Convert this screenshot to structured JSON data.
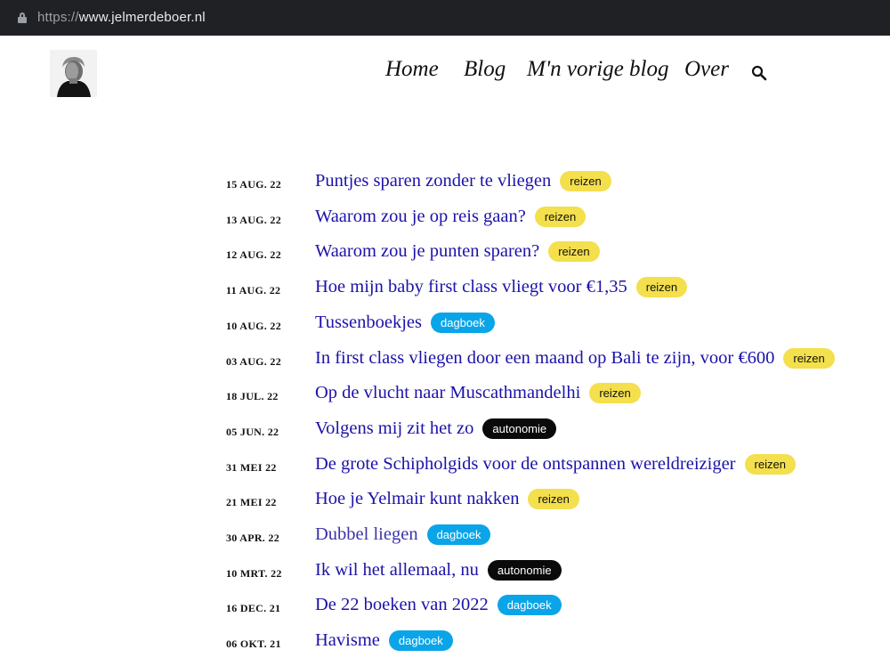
{
  "browser": {
    "url_scheme": "https://",
    "url_host": "www.jelmerdeboer.nl"
  },
  "nav": {
    "items": [
      {
        "label": "Home"
      },
      {
        "label": "Blog"
      },
      {
        "label": "M'n vorige blog"
      },
      {
        "label": "Over"
      }
    ]
  },
  "posts": [
    {
      "date": "15 AUG. 22",
      "title": "Puntjes sparen zonder te vliegen",
      "tag": "reizen"
    },
    {
      "date": "13 AUG. 22",
      "title": "Waarom zou je op reis gaan?",
      "tag": "reizen"
    },
    {
      "date": "12 AUG. 22",
      "title": "Waarom zou je punten sparen?",
      "tag": "reizen"
    },
    {
      "date": "11 AUG. 22",
      "title": "Hoe mijn baby first class vliegt voor €1,35",
      "tag": "reizen"
    },
    {
      "date": "10 AUG. 22",
      "title": "Tussenboekjes",
      "tag": "dagboek"
    },
    {
      "date": "03 AUG. 22",
      "title": "In first class vliegen door een maand op Bali te zijn, voor €600",
      "tag": "reizen"
    },
    {
      "date": "18 JUL. 22",
      "title": "Op de vlucht naar Muscathmandelhi",
      "tag": "reizen"
    },
    {
      "date": "05 JUN. 22",
      "title": "Volgens mij zit het zo",
      "tag": "autonomie"
    },
    {
      "date": "31 MEI 22",
      "title": "De grote Schipholgids voor de ontspannen wereldreiziger",
      "tag": "reizen"
    },
    {
      "date": "21 MEI 22",
      "title": "Hoe je Yelmair kunt nakken",
      "tag": "reizen"
    },
    {
      "date": "30 APR. 22",
      "title": "Dubbel liegen",
      "tag": "dagboek"
    },
    {
      "date": "10 MRT. 22",
      "title": "Ik wil het allemaal, nu",
      "tag": "autonomie"
    },
    {
      "date": "16 DEC. 21",
      "title": "De 22 boeken van 2022",
      "tag": "dagboek"
    },
    {
      "date": "06 OKT. 21",
      "title": "Havisme",
      "tag": "dagboek"
    }
  ],
  "colors": {
    "link": "#1c12a8",
    "tag_reizen": "#f4df4d",
    "tag_dagboek": "#0aa5e8",
    "tag_autonomie": "#0a0a0a"
  }
}
